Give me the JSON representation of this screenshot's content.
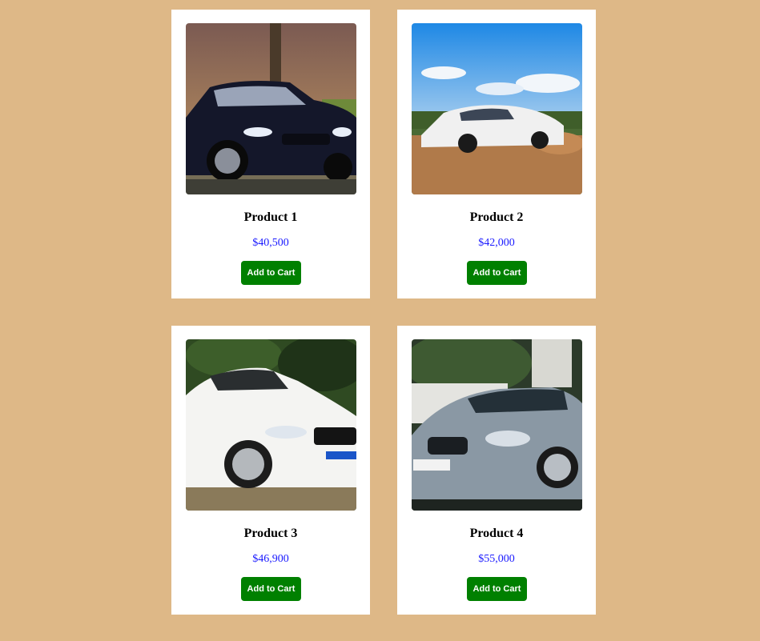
{
  "products": [
    {
      "title": "Product 1",
      "price": "$40,500",
      "button_label": "Add to Cart"
    },
    {
      "title": "Product 2",
      "price": "$42,000",
      "button_label": "Add to Cart"
    },
    {
      "title": "Product 3",
      "price": "$46,900",
      "button_label": "Add to Cart"
    },
    {
      "title": "Product 4",
      "price": "$55,000",
      "button_label": "Add to Cart"
    }
  ],
  "colors": {
    "page_background": "#deb887",
    "card_background": "#ffffff",
    "price_text": "#1a1aff",
    "button_background": "#008000",
    "button_text": "#ffffff"
  }
}
